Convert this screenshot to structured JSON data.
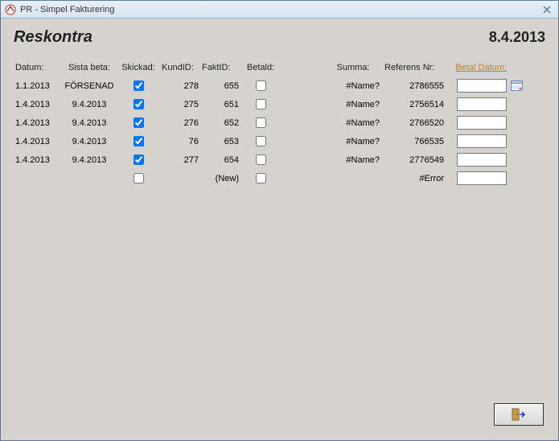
{
  "window": {
    "title": "PR - Simpel Fakturering"
  },
  "page": {
    "title": "Reskontra",
    "date": "8.4.2013"
  },
  "headers": {
    "datum": "Datum:",
    "sista": "Sista beta:",
    "skickad": "Skickad:",
    "kundid": "KundID:",
    "faktid": "FaktID:",
    "betald": "Betald:",
    "summa": "Summa:",
    "referens": "Referens Nr:",
    "betaldatum": "Betal Datum:"
  },
  "rows": [
    {
      "datum": "1.1.2013",
      "sista": "FÖRSENAD",
      "skickad": true,
      "kundid": "278",
      "faktid": "655",
      "betald": false,
      "summa": "#Name?",
      "referens": "2786555",
      "betaldatum": "",
      "showCal": true
    },
    {
      "datum": "1.4.2013",
      "sista": "9.4.2013",
      "skickad": true,
      "kundid": "275",
      "faktid": "651",
      "betald": false,
      "summa": "#Name?",
      "referens": "2756514",
      "betaldatum": "",
      "showCal": false
    },
    {
      "datum": "1.4.2013",
      "sista": "9.4.2013",
      "skickad": true,
      "kundid": "276",
      "faktid": "652",
      "betald": false,
      "summa": "#Name?",
      "referens": "2766520",
      "betaldatum": "",
      "showCal": false
    },
    {
      "datum": "1.4.2013",
      "sista": "9.4.2013",
      "skickad": true,
      "kundid": "76",
      "faktid": "653",
      "betald": false,
      "summa": "#Name?",
      "referens": "766535",
      "betaldatum": "",
      "showCal": false
    },
    {
      "datum": "1.4.2013",
      "sista": "9.4.2013",
      "skickad": true,
      "kundid": "277",
      "faktid": "654",
      "betald": false,
      "summa": "#Name?",
      "referens": "2776549",
      "betaldatum": "",
      "showCal": false
    },
    {
      "datum": "",
      "sista": "",
      "skickad": false,
      "kundid": "",
      "faktid": "(New)",
      "betald": false,
      "summa": "",
      "referens": "#Error",
      "betaldatum": "",
      "showCal": false
    }
  ]
}
